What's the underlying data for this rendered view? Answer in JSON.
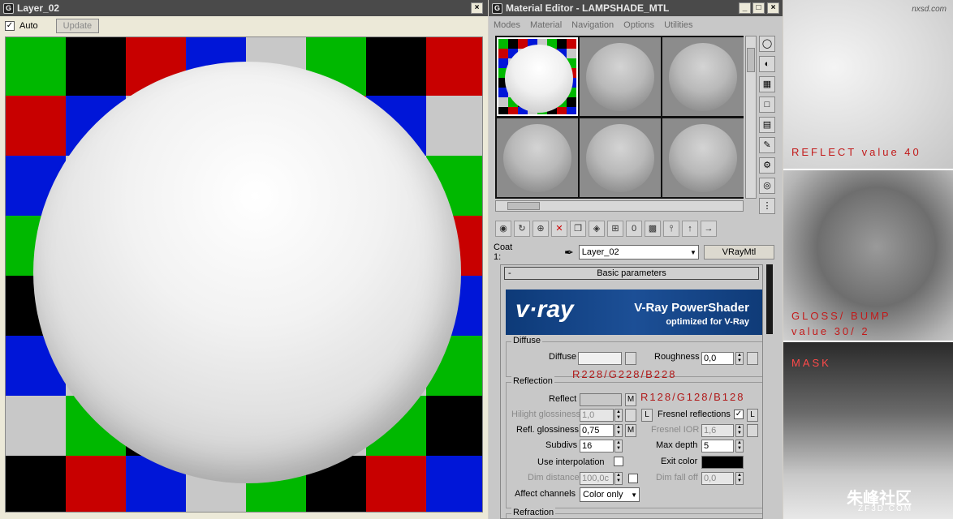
{
  "left_window": {
    "title": "Layer_02",
    "auto_label": "Auto",
    "auto_checked": "✓",
    "update_label": "Update",
    "checker_colors": [
      "#00b800",
      "#0016d8",
      "#000000",
      "#c8c8c8",
      "#c80000"
    ],
    "close_glyph": "×"
  },
  "material_editor": {
    "title": "Material Editor - LAMPSHADE_MTL",
    "menu": [
      "Modes",
      "Material",
      "Navigation",
      "Options",
      "Utilities"
    ],
    "coat_label": "Coat 1:",
    "material_name": "Layer_02",
    "material_type": "VRayMtl",
    "rollout_title": "Basic parameters",
    "rollout_toggle": "-",
    "banner": {
      "brand": "v·ray",
      "product": "V-Ray PowerShader",
      "tagline": "optimized for V-Ray"
    },
    "diffuse": {
      "group": "Diffuse",
      "diffuse_label": "Diffuse",
      "diffuse_color": "#f0f0f0",
      "roughness_label": "Roughness",
      "roughness_value": "0,0"
    },
    "reflection": {
      "group": "Reflection",
      "reflect_label": "Reflect",
      "reflect_color": "#c8c8c8",
      "hilight_label": "Hilight glossiness",
      "hilight_value": "1,0",
      "refl_gloss_label": "Refl. glossiness",
      "refl_gloss_value": "0,75",
      "subdivs_label": "Subdivs",
      "subdivs_value": "16",
      "use_interp_label": "Use interpolation",
      "dim_distance_label": "Dim distance",
      "dim_distance_value": "100,0c",
      "affect_label": "Affect channels",
      "affect_value": "Color only",
      "fresnel_label": "Fresnel reflections",
      "fresnel_checked": "✓",
      "fresnel_ior_label": "Fresnel IOR",
      "fresnel_ior_value": "1,6",
      "max_depth_label": "Max depth",
      "max_depth_value": "5",
      "exit_color_label": "Exit color",
      "exit_color": "#000000",
      "dim_falloff_label": "Dim fall off",
      "dim_falloff_value": "0,0",
      "m_label": "M",
      "l_label": "L"
    },
    "refraction_group": "Refraction",
    "annotations": {
      "diffuse_rgb": "R228/G228/B228",
      "reflect_rgb": "R128/G128/B128"
    }
  },
  "textures": {
    "reflect": "REFLECT value 40",
    "gloss_line1": "GLOSS/ BUMP",
    "gloss_line2": "value 30/ 2",
    "mask": "MASK",
    "watermark_bottom": "朱峰社区",
    "watermark_bottom_url": "ZF3D.COM",
    "watermark_top_url": "nxsd.com"
  }
}
